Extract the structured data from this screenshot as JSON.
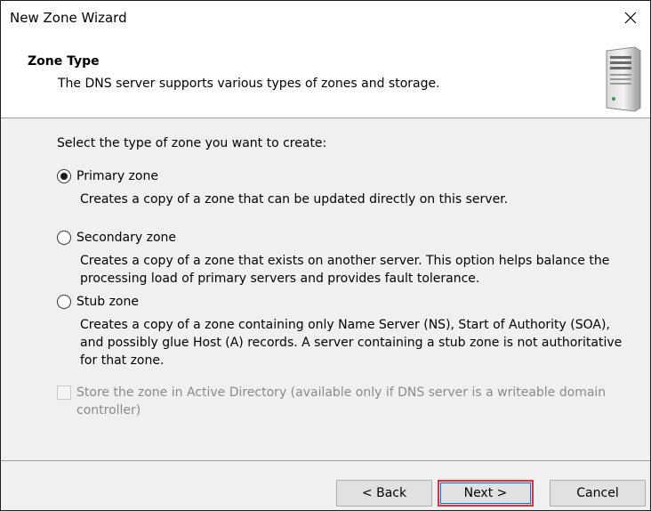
{
  "window": {
    "title": "New Zone Wizard"
  },
  "header": {
    "title": "Zone Type",
    "subtitle": "The DNS server supports various types of zones and storage.",
    "icon": "server-tower-icon"
  },
  "prompt": "Select the type of zone you want to create:",
  "zone_types": [
    {
      "label": "Primary zone",
      "checked": true,
      "description": "Creates a copy of a zone that can be updated directly on this server."
    },
    {
      "label": "Secondary zone",
      "checked": false,
      "description": "Creates a copy of a zone that exists on another server. This option helps balance the processing load of primary servers and provides fault tolerance."
    },
    {
      "label": "Stub zone",
      "checked": false,
      "description": "Creates a copy of a zone containing only Name Server (NS), Start of Authority (SOA), and possibly glue Host (A) records. A server containing a stub zone is not authoritative for that zone."
    }
  ],
  "store_in_ad": {
    "label": "Store the zone in Active Directory (available only if DNS server is a writeable domain controller)",
    "checked": false,
    "enabled": false
  },
  "buttons": {
    "back": "< Back",
    "next": "Next >",
    "cancel": "Cancel"
  },
  "colors": {
    "highlight": "#e0303a",
    "focus": "#0078d7"
  }
}
